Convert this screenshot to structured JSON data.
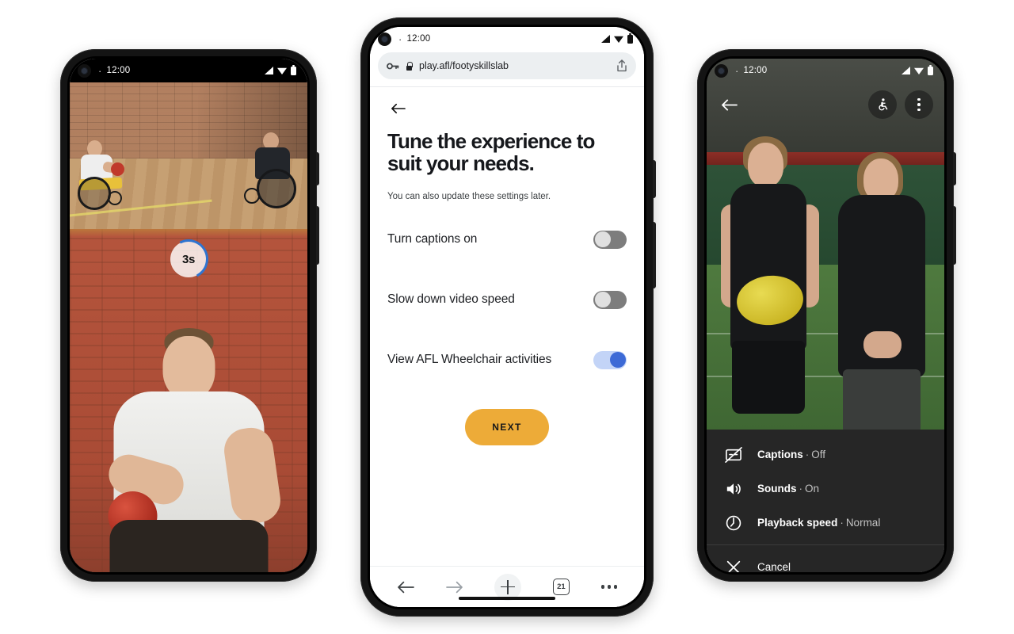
{
  "statusbar": {
    "dot": "·",
    "time": "12:00"
  },
  "phone_left": {
    "name": "video-countdown-screen",
    "countdown": "3s",
    "scene": "Indoor gym: two AFL wheelchair players facing each other on a timber court, brick wall background; foreground man in white t-shirt holding a red ball."
  },
  "phone_center": {
    "browser": {
      "url": "play.afl/footyskillslab",
      "key_icon": "password-key-icon",
      "lock_icon": "lock-icon",
      "share_icon": "share-icon"
    },
    "page": {
      "back_icon": "arrow-back-icon",
      "title": "Tune the experience to suit your needs.",
      "subtitle": "You can also update these settings later.",
      "settings": [
        {
          "label": "Turn captions on",
          "state": "off"
        },
        {
          "label": "Slow down video speed",
          "state": "off"
        },
        {
          "label": "View AFL Wheelchair activities",
          "state": "on"
        }
      ],
      "next_label": "NEXT"
    },
    "bottombar": {
      "back_icon": "arrow-back-icon",
      "forward_icon": "arrow-forward-icon",
      "new_tab_icon": "plus-icon",
      "tab_count": "21",
      "more_icon": "more-horizontal-icon"
    }
  },
  "phone_right": {
    "topbar": {
      "back_icon": "arrow-back-icon",
      "accessibility_icon": "wheelchair-accessibility-icon",
      "overflow_icon": "more-vertical-icon"
    },
    "scene": "Two female AFL athletes in black training kit standing on an indoor green pitch; the left athlete holds a yellow football.",
    "menu": [
      {
        "icon": "captions-off-icon",
        "label": "Captions",
        "separator": "·",
        "value": "Off"
      },
      {
        "icon": "volume-on-icon",
        "label": "Sounds",
        "separator": "·",
        "value": "On"
      },
      {
        "icon": "playback-speed-icon",
        "label": "Playback speed",
        "separator": "·",
        "value": "Normal"
      }
    ],
    "cancel": {
      "icon": "close-icon",
      "label": "Cancel"
    }
  },
  "colors": {
    "accent_amber": "#edab38",
    "toggle_on_track": "#c3d4f7",
    "toggle_on_knob": "#3d6ad6",
    "toggle_off_track": "#7d7d7d",
    "sheet_bg": "#262626"
  }
}
